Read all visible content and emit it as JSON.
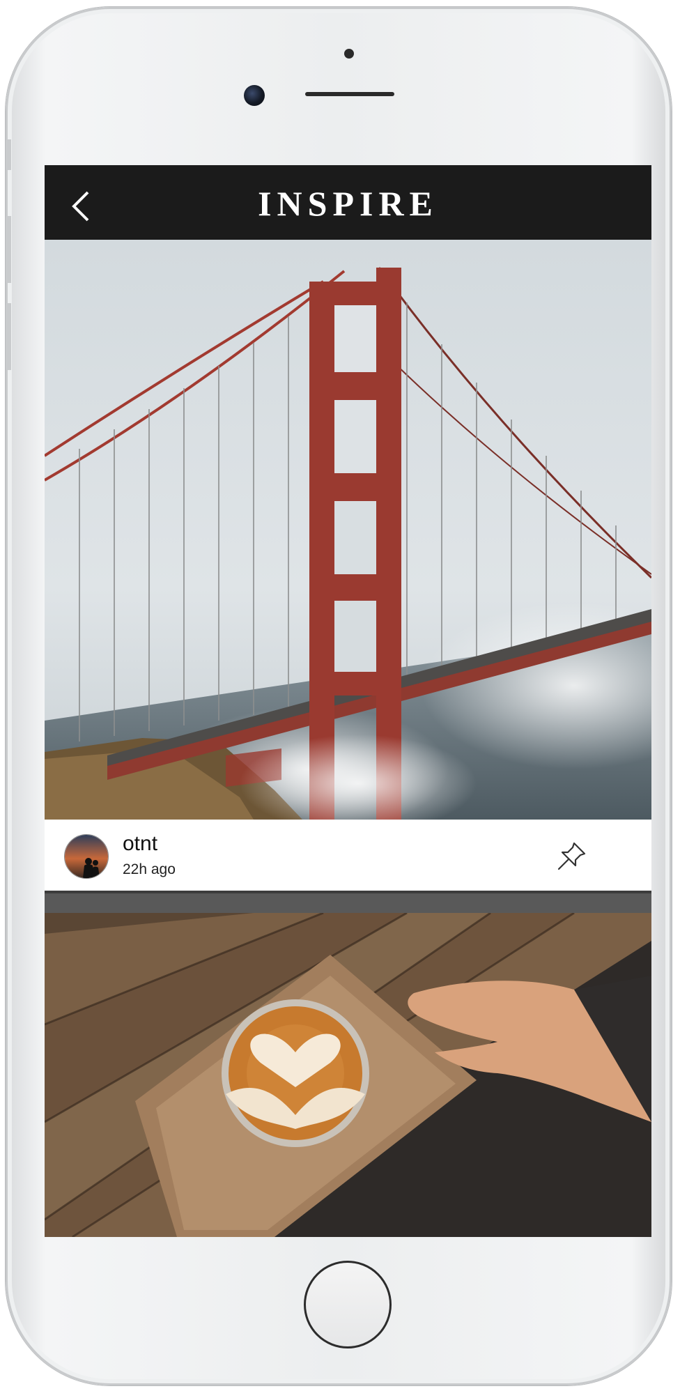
{
  "app": {
    "title": "INSPIRE",
    "back_icon": "chevron-left-icon"
  },
  "feed": {
    "posts": [
      {
        "image": "golden-gate-bridge-photo",
        "username": "otnt",
        "time_ago": "22h ago",
        "action_icon": "pin-icon"
      },
      {
        "image": "latte-art-coffee-photo"
      }
    ]
  },
  "colors": {
    "appbar_bg": "#1b1b1b",
    "bridge_red": "#9a3a30",
    "sky": "#d6dde2"
  }
}
